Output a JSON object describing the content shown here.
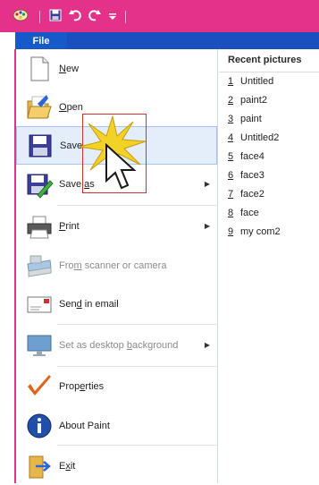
{
  "window": {
    "quick_access": [
      "paint-app-icon",
      "save-icon",
      "undo-icon",
      "redo-icon",
      "customize-dropdown-icon"
    ],
    "accent_color": "#e4328a",
    "tab_color": "#1659c9"
  },
  "tabs": {
    "file_label": "File"
  },
  "menu": {
    "items": [
      {
        "label": "New",
        "icon": "new-document-icon"
      },
      {
        "label": "Open",
        "icon": "open-folder-icon"
      },
      {
        "label": "Save",
        "icon": "save-icon"
      },
      {
        "label": "Save as",
        "icon": "save-as-icon"
      },
      {
        "label": "Print",
        "icon": "printer-icon"
      },
      {
        "label": "From scanner or camera",
        "icon": "scanner-icon"
      },
      {
        "label": "Send in email",
        "icon": "email-icon"
      },
      {
        "label": "Set as desktop background",
        "icon": "desktop-icon"
      },
      {
        "label": "Properties",
        "icon": "checkmark-icon"
      },
      {
        "label": "About Paint",
        "icon": "info-icon"
      },
      {
        "label": "Exit",
        "icon": "exit-icon"
      }
    ]
  },
  "recent": {
    "title": "Recent pictures",
    "items": [
      {
        "num": "1",
        "name": "Untitled"
      },
      {
        "num": "2",
        "name": "paint2"
      },
      {
        "num": "3",
        "name": "paint"
      },
      {
        "num": "4",
        "name": "Untitled2"
      },
      {
        "num": "5",
        "name": "face4"
      },
      {
        "num": "6",
        "name": "face3"
      },
      {
        "num": "7",
        "name": "face2"
      },
      {
        "num": "8",
        "name": "face"
      },
      {
        "num": "9",
        "name": "my com2"
      }
    ]
  }
}
